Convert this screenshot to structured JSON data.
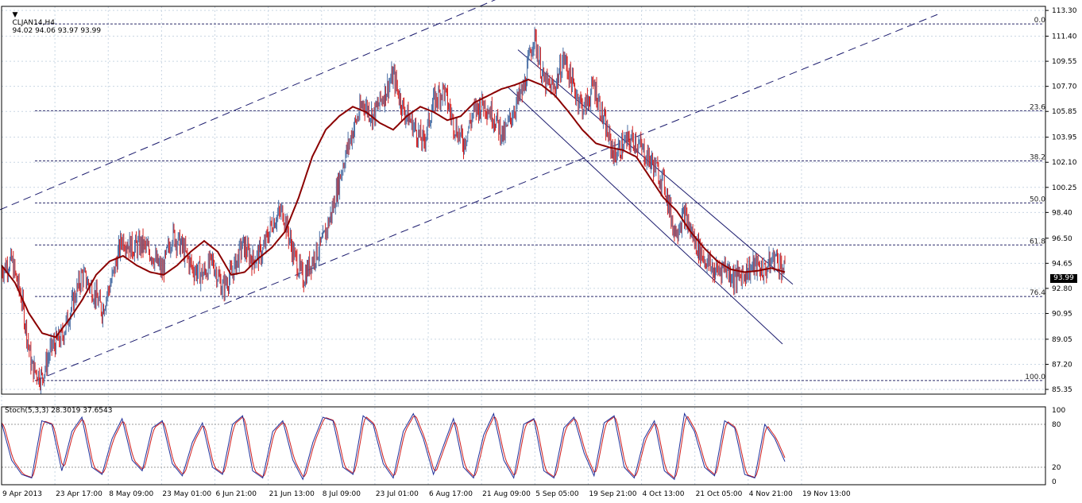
{
  "header": {
    "symbol": "CLJAN14,H4",
    "ohlc": "94.02 94.06 93.97 93.99"
  },
  "stochastic": {
    "label": "Stoch(5,3,3) 28.3019 37.6543",
    "axis_labels": [
      "100",
      "80",
      "20",
      "0"
    ]
  },
  "current_price": "93.99",
  "colors": {
    "background": "#ffffff",
    "bull_candle": "#4a6fa5",
    "bear_candle": "#d42020",
    "moving_average": "#8b0000",
    "grid": "#c9d6e3",
    "fib_lines": "#2b2b6b",
    "trend_lines": "#1c1c6e",
    "stoch_main": "#1f2f9a",
    "stoch_signal": "#d01c1c"
  },
  "chart_data": {
    "type": "line",
    "price_axis": [
      "113.30",
      "111.40",
      "109.55",
      "107.70",
      "105.85",
      "103.95",
      "102.10",
      "100.25",
      "98.40",
      "96.50",
      "94.65",
      "92.80",
      "90.95",
      "89.05",
      "87.20",
      "85.35"
    ],
    "ylim": [
      85.0,
      113.6
    ],
    "time_axis": [
      "9 Apr 2013",
      "23 Apr 17:00",
      "8 May 09:00",
      "23 May 01:00",
      "6 Jun 21:00",
      "21 Jun 13:00",
      "8 Jul 09:00",
      "23 Jul 01:00",
      "6 Aug 17:00",
      "21 Aug 09:00",
      "5 Sep 05:00",
      "19 Sep 21:00",
      "4 Oct 13:00",
      "21 Oct 05:00",
      "4 Nov 21:00",
      "19 Nov 13:00"
    ],
    "fibonacci": [
      {
        "label": "0.0",
        "price": 112.3
      },
      {
        "label": "23.6",
        "price": 105.9
      },
      {
        "label": "38.2",
        "price": 102.2
      },
      {
        "label": "50.0",
        "price": 99.1
      },
      {
        "label": "61.8",
        "price": 96.0
      },
      {
        "label": "76.4",
        "price": 92.2
      },
      {
        "label": "100.0",
        "price": 86.0
      }
    ],
    "close_path": [
      94.2,
      94.8,
      92.0,
      87.0,
      86.2,
      88.5,
      89.2,
      91.5,
      93.8,
      92.8,
      91.2,
      93.5,
      96.5,
      95.8,
      96.0,
      95.3,
      94.0,
      96.8,
      95.8,
      94.3,
      93.8,
      94.8,
      92.8,
      94.0,
      96.0,
      94.9,
      95.5,
      97.8,
      98.5,
      95.5,
      93.5,
      95.0,
      96.2,
      98.8,
      102.0,
      104.5,
      106.5,
      105.5,
      107.0,
      108.5,
      106.0,
      104.8,
      103.5,
      106.5,
      107.5,
      105.0,
      103.5,
      105.8,
      106.5,
      105.5,
      104.0,
      106.0,
      107.5,
      111.5,
      108.0,
      107.5,
      109.8,
      107.5,
      106.0,
      107.8,
      105.0,
      102.6,
      103.5,
      103.8,
      102.8,
      101.8,
      100.5,
      97.0,
      98.2,
      96.3,
      95.0,
      94.0,
      94.5,
      93.5,
      94.0,
      94.5,
      94.1,
      95.2,
      93.99
    ],
    "moving_average": [
      94.5,
      93.2,
      91.0,
      89.5,
      89.2,
      90.5,
      92.0,
      93.8,
      94.8,
      95.2,
      94.5,
      94.0,
      93.8,
      94.5,
      95.5,
      96.3,
      95.5,
      93.8,
      94.0,
      95.0,
      95.8,
      97.0,
      99.5,
      102.5,
      104.5,
      105.5,
      106.2,
      105.8,
      105.0,
      104.5,
      105.5,
      106.2,
      105.8,
      105.2,
      105.5,
      106.5,
      107.0,
      107.5,
      107.8,
      108.2,
      107.8,
      107.0,
      105.8,
      104.5,
      103.5,
      103.2,
      103.0,
      102.5,
      101.0,
      99.5,
      98.5,
      97.0,
      95.8,
      94.8,
      94.2,
      94.0,
      94.1,
      94.3,
      94.0
    ],
    "stochastic_values": [
      82,
      30,
      10,
      5,
      85,
      80,
      15,
      70,
      90,
      20,
      10,
      60,
      88,
      30,
      15,
      75,
      85,
      25,
      8,
      55,
      82,
      20,
      10,
      80,
      92,
      15,
      5,
      70,
      85,
      30,
      3,
      55,
      90,
      85,
      20,
      10,
      92,
      80,
      25,
      5,
      70,
      95,
      60,
      10,
      50,
      88,
      20,
      5,
      65,
      95,
      30,
      5,
      80,
      88,
      15,
      5,
      75,
      90,
      40,
      8,
      82,
      92,
      20,
      5,
      60,
      85,
      15,
      3,
      95,
      70,
      20,
      8,
      85,
      75,
      10,
      5,
      80,
      60,
      28
    ]
  }
}
